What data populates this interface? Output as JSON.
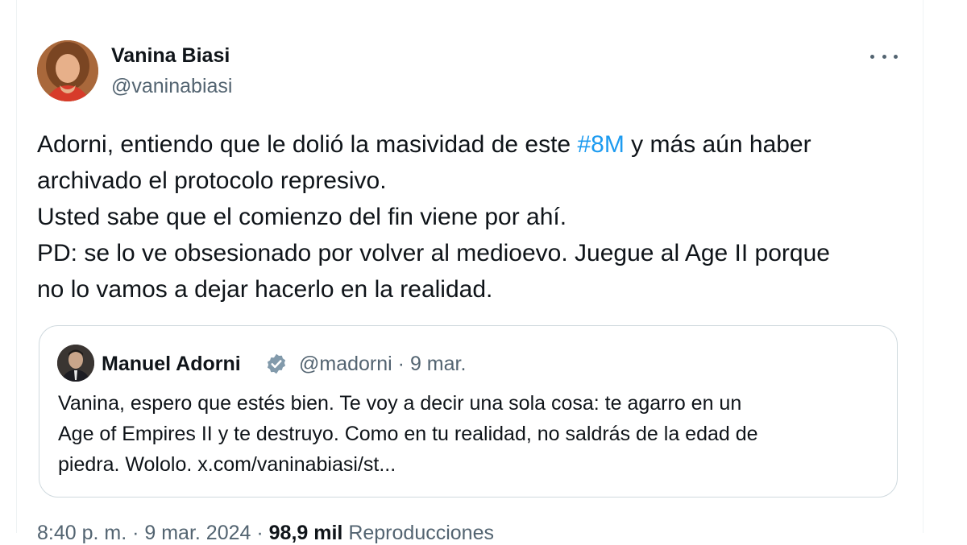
{
  "author": {
    "name": "Vanina Biasi",
    "handle": "@vaninabiasi"
  },
  "tweet": {
    "line1_before": "Adorni, entiendo que le dolió la masividad de este ",
    "hashtag": "#8M",
    "line1_after": " y más aún haber",
    "line2": "archivado el protocolo represivo.",
    "line3": "Usted sabe que el comienzo del fin viene por ahí.",
    "line4": "PD: se lo ve obsesionado por volver al medioevo. Juegue al Age II porque",
    "line5": "no lo vamos a dejar hacerlo en la realidad."
  },
  "quote": {
    "name": "Manuel Adorni",
    "handle": "@madorni",
    "separator": "·",
    "date": "9 mar.",
    "line1": "Vanina, espero que estés bien. Te voy a decir una sola cosa: te agarro en un",
    "line2": "Age of Empires II y te destruyo. Como en tu realidad, no saldrás de la edad de",
    "line3": "piedra. Wololo. x.com/vaninabiasi/st..."
  },
  "footer": {
    "time_date": "8:40 p. m. · 9 mar. 2024 · ",
    "views": "98,9 mil",
    "views_label": " Reproducciones"
  },
  "colors": {
    "link": "#1d9bf0",
    "secondary_text": "#536471",
    "border": "#cfd9de",
    "verified": "#829aab"
  },
  "icons": {
    "more": "more-horizontal-icon",
    "verified": "verified-badge-icon"
  }
}
